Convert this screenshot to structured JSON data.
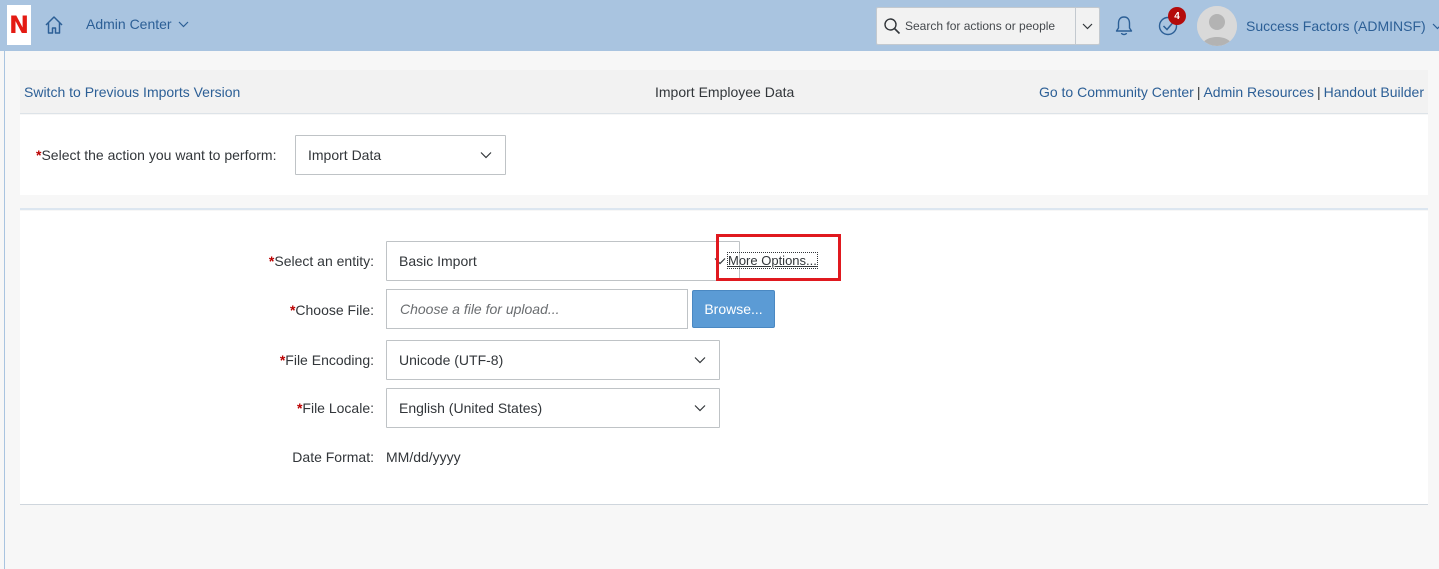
{
  "shellbar": {
    "logo_letter": "N",
    "admin_center_label": "Admin Center",
    "search_placeholder": "Search for actions or people",
    "notifications_badge": "4",
    "user_name": "Success Factors (ADMINSF)"
  },
  "subheader": {
    "left_link": "Switch to Previous Imports Version",
    "title": "Import Employee Data",
    "right_links": [
      "Go to Community Center",
      "Admin Resources",
      "Handout Builder"
    ],
    "separator": "|"
  },
  "action": {
    "required_mark": "*",
    "label": "Select the action you want to perform:",
    "selected": "Import Data"
  },
  "form": {
    "entity": {
      "required_mark": "*",
      "label": "Select an entity:",
      "selected": "Basic Import"
    },
    "more_options": "More Options...",
    "file": {
      "required_mark": "*",
      "label": "Choose File:",
      "placeholder": "Choose a file for upload...",
      "browse_label": "Browse..."
    },
    "encoding": {
      "required_mark": "*",
      "label": "File Encoding:",
      "selected": "Unicode (UTF-8)"
    },
    "locale": {
      "required_mark": "*",
      "label": "File Locale:",
      "selected": "English (United States)"
    },
    "date_format": {
      "label": "Date Format:",
      "value": "MM/dd/yyyy"
    }
  },
  "colors": {
    "shellbar_bg": "#a9c4e0",
    "link": "#2c5f96",
    "required": "#bb0000",
    "browse_button": "#5b9bd5",
    "highlight_box": "#e0191f",
    "badge": "#b40b0b"
  },
  "icons": {
    "home": "home-icon",
    "search": "search-icon",
    "bell": "bell-icon",
    "todo": "check-circle-icon",
    "avatar": "user-avatar-icon",
    "dropdown": "chevron-down-icon"
  }
}
